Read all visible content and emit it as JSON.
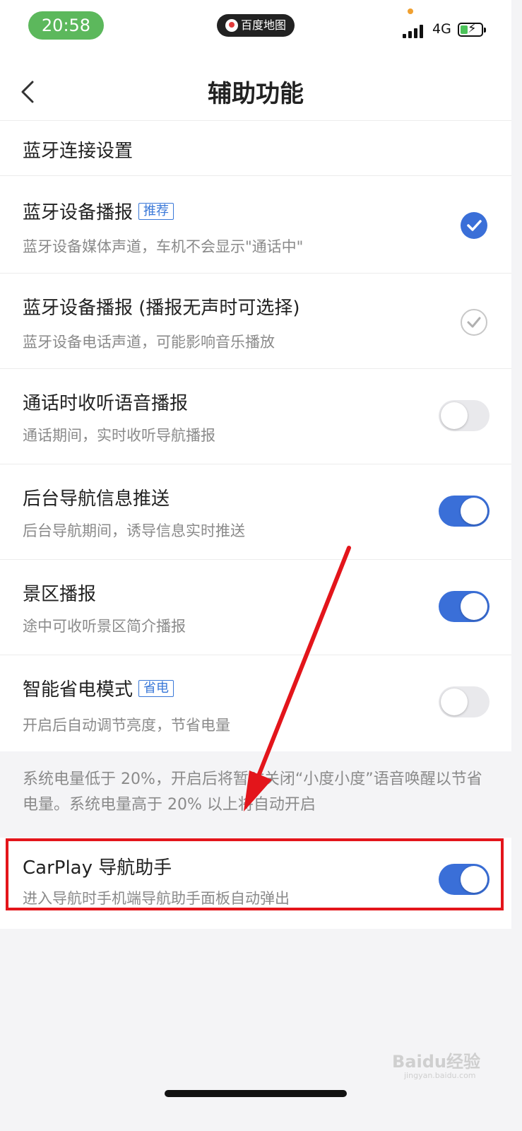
{
  "status_bar": {
    "time": "20:58",
    "app": "百度地图",
    "network": "4G"
  },
  "header": {
    "title": "辅助功能"
  },
  "section": {
    "title": "蓝牙连接设置"
  },
  "rows": [
    {
      "title": "蓝牙设备播报",
      "badge": "推荐",
      "subtitle": "蓝牙设备媒体声道，车机不会显示\"通话中\"",
      "control": "check",
      "checked": true
    },
    {
      "title": "蓝牙设备播报 (播报无声时可选择)",
      "subtitle": "蓝牙设备电话声道，可能影响音乐播放",
      "control": "check",
      "checked": false
    },
    {
      "title": "通话时收听语音播报",
      "subtitle": "通话期间，实时收听导航播报",
      "control": "toggle",
      "on": false
    },
    {
      "title": "后台导航信息推送",
      "subtitle": "后台导航期间，诱导信息实时推送",
      "control": "toggle",
      "on": true
    },
    {
      "title": "景区播报",
      "subtitle": "途中可收听景区简介播报",
      "control": "toggle",
      "on": true
    },
    {
      "title": "智能省电模式",
      "badge": "省电",
      "subtitle": "开启后自动调节亮度，节省电量",
      "control": "toggle",
      "on": false
    }
  ],
  "note": "系统电量低于 20%，开启后将暂时关闭“小度小度”语音唤醒以节省电量。系统电量高于 20% 以上将自动开启",
  "carplay": {
    "title": "CarPlay 导航助手",
    "subtitle": "进入导航时手机端导航助手面板自动弹出",
    "on": true
  },
  "watermark": {
    "text": "Baidu经验",
    "sub": "jingyan.baidu.com"
  },
  "colors": {
    "accent": "#3a6fd8",
    "status_green": "#5cb85c",
    "highlight_red": "#e3151b"
  }
}
